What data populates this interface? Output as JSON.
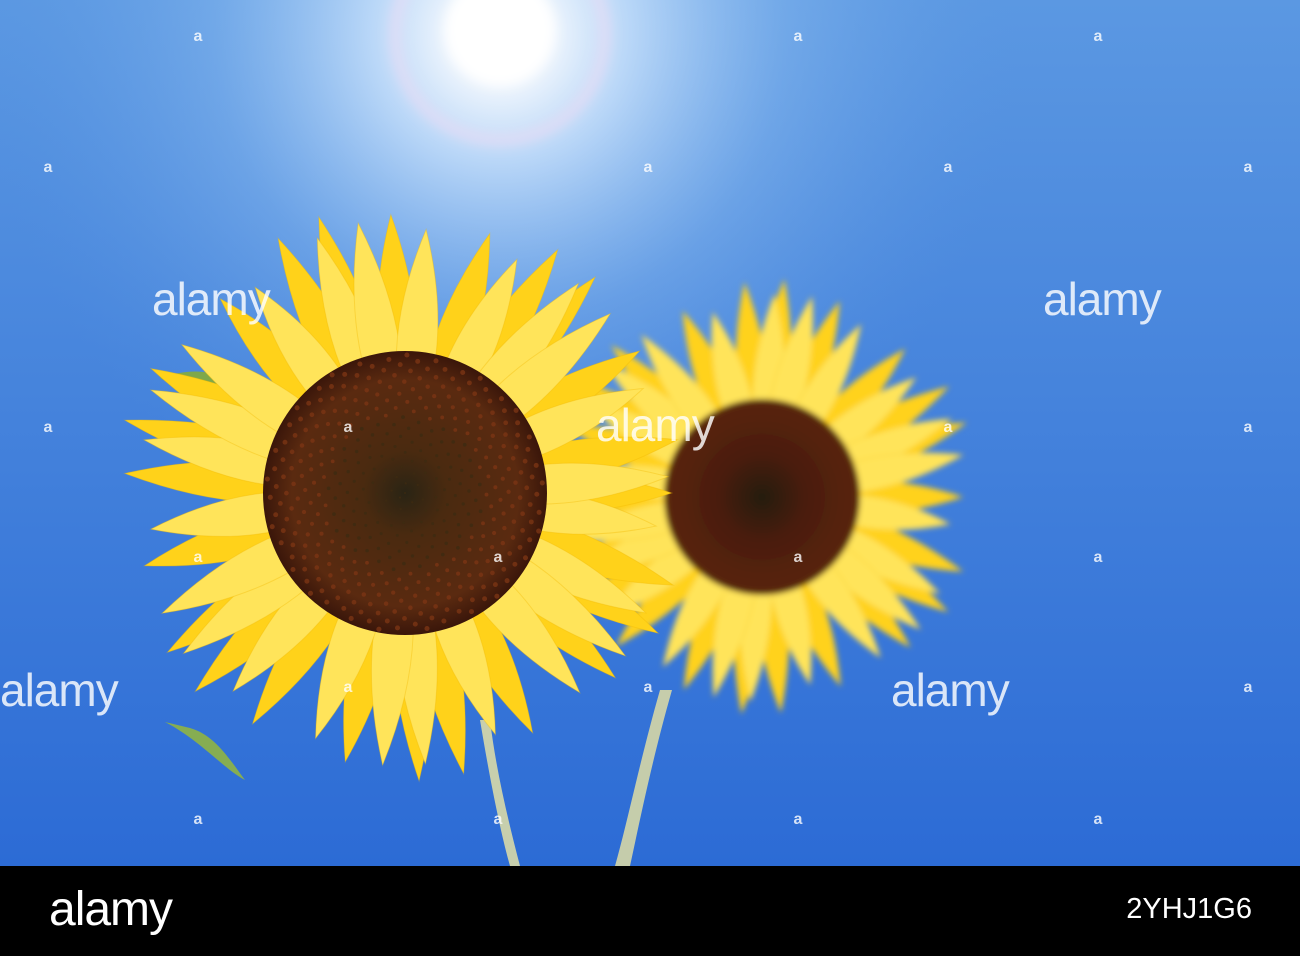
{
  "colors": {
    "sky_top": "#4e8edc",
    "sky_bottom": "#2f6fd6",
    "sun_glow": "#ffffff",
    "petal": "#ffd21a",
    "petal_light": "#ffe45a",
    "disk_dark": "#3a1a0c",
    "disk_ring": "#5a2810",
    "leaf": "#7fa84a",
    "stem": "#d9d8a0",
    "footer_bg": "#000000"
  },
  "watermark": {
    "text": "alamy",
    "dot": "a"
  },
  "footer": {
    "logo": "alamy",
    "image_id": "2YHJ1G6"
  }
}
